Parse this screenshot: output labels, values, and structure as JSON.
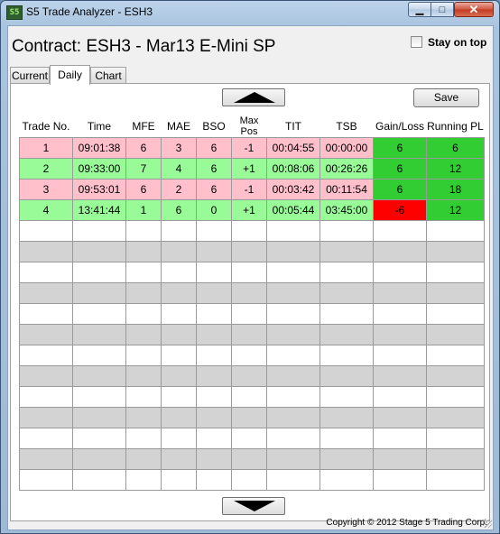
{
  "window": {
    "title": "S5 Trade Analyzer - ESH3",
    "icon": "app-icon-s5",
    "icon_text": "S5"
  },
  "header": {
    "contract": "Contract: ESH3 - Mar13 E-Mini SP",
    "stay_on_top": {
      "label": "Stay on top",
      "checked": false
    }
  },
  "tabs": [
    {
      "label": "Current",
      "active": false
    },
    {
      "label": "Daily",
      "active": true
    },
    {
      "label": "Chart",
      "active": false
    }
  ],
  "toolbar": {
    "save_label": "Save",
    "scroll_up_icon": "triangle-up-icon",
    "scroll_down_icon": "triangle-down-icon"
  },
  "table": {
    "columns": [
      "Trade No.",
      "Time",
      "MFE",
      "MAE",
      "BSO",
      "Max Pos",
      "TIT",
      "TSB",
      "Gain/Loss",
      "Running PL"
    ],
    "rows": [
      [
        "1",
        "09:01:38",
        "6",
        "3",
        "6",
        "-1",
        "00:04:55",
        "00:00:00",
        "6",
        "6"
      ],
      [
        "2",
        "09:33:00",
        "7",
        "4",
        "6",
        "+1",
        "00:08:06",
        "00:26:26",
        "6",
        "12"
      ],
      [
        "3",
        "09:53:01",
        "6",
        "2",
        "6",
        "-1",
        "00:03:42",
        "00:11:54",
        "6",
        "18"
      ],
      [
        "4",
        "13:41:44",
        "1",
        "6",
        "0",
        "+1",
        "00:05:44",
        "03:45:00",
        "-6",
        "12"
      ]
    ],
    "row_styles": [
      "loss",
      "win",
      "loss",
      "win"
    ],
    "gain_styles": [
      "pos",
      "pos",
      "pos",
      "neg"
    ],
    "empty_rows": 13,
    "colors": {
      "short_row": "#ffc0cb",
      "long_row": "#98fb98",
      "gain_positive": "#32cd32",
      "gain_negative": "#ff0000",
      "empty_alt": "#d3d3d3"
    }
  },
  "status": {
    "copyright": "Copyright © 2012 Stage 5 Trading Corp."
  }
}
